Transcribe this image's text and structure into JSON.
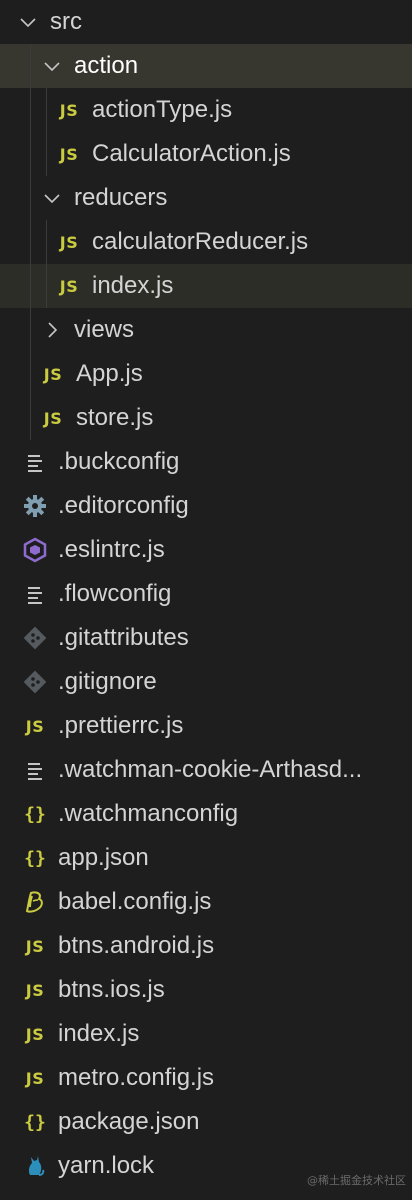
{
  "tree": {
    "src": "src",
    "action": "action",
    "actionType": "actionType.js",
    "calculatorAction": "CalculatorAction.js",
    "reducers": "reducers",
    "calculatorReducer": "calculatorReducer.js",
    "reducersIndex": "index.js",
    "views": "views",
    "app": "App.js",
    "store": "store.js",
    "buckconfig": ".buckconfig",
    "editorconfig": ".editorconfig",
    "eslintrc": ".eslintrc.js",
    "flowconfig": ".flowconfig",
    "gitattributes": ".gitattributes",
    "gitignore": ".gitignore",
    "prettierrc": ".prettierrc.js",
    "watchmanCookie": ".watchman-cookie-Arthasd...",
    "watchmanconfig": ".watchmanconfig",
    "appJson": "app.json",
    "babelConfig": "babel.config.js",
    "btnsAndroid": "btns.android.js",
    "btnsIos": "btns.ios.js",
    "rootIndex": "index.js",
    "metroConfig": "metro.config.js",
    "packageJson": "package.json",
    "yarnLock": "yarn.lock"
  },
  "icons": {
    "js": "JS",
    "json": "{}"
  },
  "watermark": "@稀土掘金技术社区",
  "colors": {
    "background": "#1e1e1e",
    "selected": "#37372f",
    "jsIcon": "#cbcb41",
    "eslint": "#8f6bd0",
    "gear": "#7f9fb1"
  }
}
